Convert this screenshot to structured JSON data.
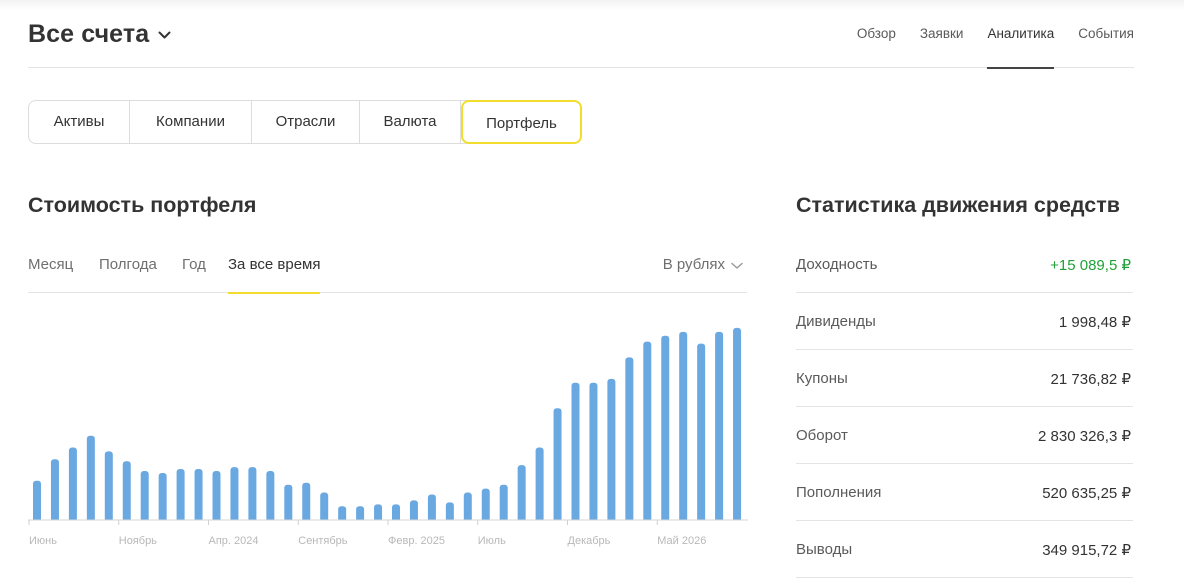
{
  "header": {
    "account_title": "Все счета",
    "nav": [
      {
        "label": "Обзор",
        "active": false
      },
      {
        "label": "Заявки",
        "active": false
      },
      {
        "label": "Аналитика",
        "active": true
      },
      {
        "label": "События",
        "active": false
      }
    ]
  },
  "segments": [
    {
      "label": "Активы",
      "active": false
    },
    {
      "label": "Компании",
      "active": false
    },
    {
      "label": "Отрасли",
      "active": false
    },
    {
      "label": "Валюта",
      "active": false
    },
    {
      "label": "Портфель",
      "active": true
    }
  ],
  "portfolio": {
    "title": "Стоимость портфеля",
    "periods": [
      {
        "label": "Месяц",
        "active": false
      },
      {
        "label": "Полгода",
        "active": false
      },
      {
        "label": "Год",
        "active": false
      },
      {
        "label": "За все время",
        "active": true
      }
    ],
    "currency_label": "В рублях"
  },
  "stats": {
    "title": "Статистика движения средств",
    "rows": [
      {
        "label": "Доходность",
        "value": "+15 089,5 ₽",
        "positive": true
      },
      {
        "label": "Дивиденды",
        "value": "1 998,48 ₽",
        "positive": false
      },
      {
        "label": "Купоны",
        "value": "21 736,82 ₽",
        "positive": false
      },
      {
        "label": "Оборот",
        "value": "2 830 326,3 ₽",
        "positive": false
      },
      {
        "label": "Пополнения",
        "value": "520 635,25 ₽",
        "positive": false
      },
      {
        "label": "Выводы",
        "value": "349 915,72 ₽",
        "positive": false
      }
    ]
  },
  "colors": {
    "bar": "#6aa8e2",
    "accent_yellow": "#f3dd2c",
    "positive_green": "#21a038"
  },
  "chart_data": {
    "type": "bar",
    "x_tick_labels": [
      "Июнь",
      "Ноябрь",
      "Апр. 2024",
      "Сентябрь",
      "Февр. 2025",
      "Июль",
      "Декабрь",
      "Май 2026"
    ],
    "x_tick_bar_index": [
      0,
      5,
      10,
      15,
      20,
      25,
      30,
      35
    ],
    "values": [
      20,
      31,
      37,
      43,
      35,
      30,
      25,
      24,
      26,
      26,
      25,
      27,
      27,
      25,
      18,
      19,
      14,
      7,
      7,
      8,
      8,
      10,
      13,
      9,
      14,
      16,
      18,
      28,
      37,
      57,
      70,
      70,
      72,
      83,
      91,
      94,
      96,
      90,
      96,
      98
    ],
    "ylim": [
      0,
      100
    ],
    "grid": false,
    "legend": "none"
  },
  "icons": {
    "account_dropdown": "chevron-down-icon",
    "currency_dropdown": "chevron-down-icon"
  }
}
